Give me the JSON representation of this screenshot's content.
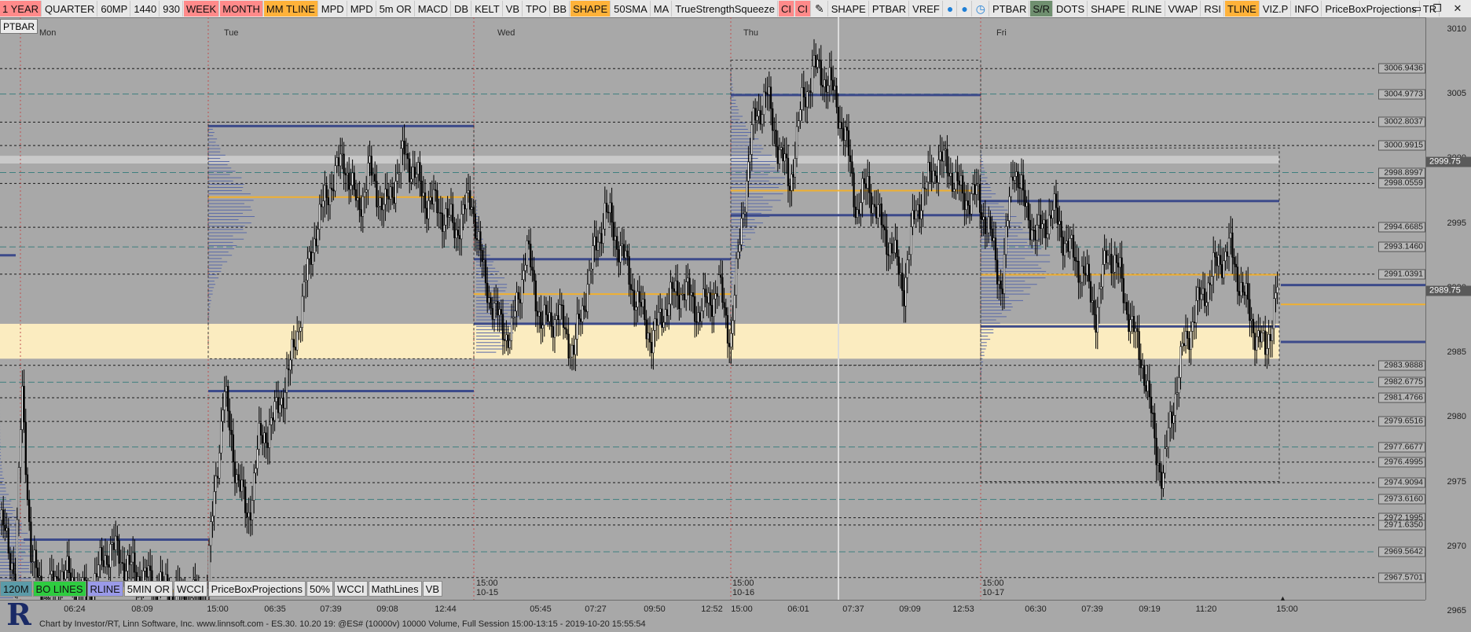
{
  "toolbar": {
    "items": [
      {
        "label": "1 YEAR",
        "bg": "#ff8a8a"
      },
      {
        "label": "QUARTER",
        "bg": ""
      },
      {
        "label": "60MP",
        "bg": ""
      },
      {
        "label": "1440",
        "bg": ""
      },
      {
        "label": "930",
        "bg": ""
      },
      {
        "label": "WEEK",
        "bg": "#ff8a8a"
      },
      {
        "label": "MONTH",
        "bg": "#ff8a8a"
      },
      {
        "label": "MM TLINE",
        "bg": "#ffb23a"
      },
      {
        "label": "MPD",
        "bg": ""
      },
      {
        "label": "MPD",
        "bg": ""
      },
      {
        "label": "5m OR",
        "bg": ""
      },
      {
        "label": "MACD",
        "bg": ""
      },
      {
        "label": "DB",
        "bg": ""
      },
      {
        "label": "KELT",
        "bg": ""
      },
      {
        "label": "VB",
        "bg": ""
      },
      {
        "label": "TPO",
        "bg": ""
      },
      {
        "label": "BB",
        "bg": ""
      },
      {
        "label": "SHAPE",
        "bg": "#ffb23a"
      },
      {
        "label": "50SMA",
        "bg": ""
      },
      {
        "label": "MA",
        "bg": ""
      },
      {
        "label": "TrueStrengthSqueeze",
        "bg": ""
      },
      {
        "label": "CI",
        "bg": "#ff8a8a"
      },
      {
        "label": "CI",
        "bg": "#ff8a8a"
      }
    ],
    "items2": [
      {
        "label": "SHAPE",
        "bg": ""
      },
      {
        "label": "PTBAR",
        "bg": ""
      },
      {
        "label": "VREF",
        "bg": ""
      }
    ],
    "items3": [
      {
        "label": "PTBAR",
        "bg": ""
      },
      {
        "label": "S/R",
        "bg": "#6f8f6f"
      },
      {
        "label": "DOTS",
        "bg": ""
      },
      {
        "label": "SHAPE",
        "bg": ""
      },
      {
        "label": "RLINE",
        "bg": ""
      },
      {
        "label": "VWAP",
        "bg": ""
      },
      {
        "label": "RSI",
        "bg": ""
      },
      {
        "label": "TLINE",
        "bg": "#ffb23a"
      },
      {
        "label": "VIZ.P",
        "bg": ""
      },
      {
        "label": "INFO",
        "bg": ""
      },
      {
        "label": "PriceBoxProjections",
        "bg": ""
      },
      {
        "label": "TR",
        "bg": ""
      }
    ]
  },
  "ptbar_label": "PTBAR",
  "days": [
    "Mon",
    "Tue",
    "Wed",
    "Thu",
    "Fri"
  ],
  "price_axis": {
    "ticks": [
      "3010",
      "3005",
      "3000",
      "2995",
      "2990",
      "2985",
      "2980",
      "2975",
      "2970",
      "2965"
    ],
    "current_prices": [
      {
        "value": "2999.75",
        "bg": "#5a5a5a"
      },
      {
        "value": "2989.75",
        "bg": "#5a5a5a"
      }
    ]
  },
  "levels": [
    "3006.9436",
    "3004.9773",
    "3002.8037",
    "3000.9915",
    "2998.8997",
    "2998.0559",
    "2994.6685",
    "2993.1460",
    "2991.0391",
    "2983.9888",
    "2982.6775",
    "2981.4766",
    "2979.6516",
    "2977.6677",
    "2976.4995",
    "2974.9094",
    "2973.6160",
    "2972.1995",
    "2971.6350",
    "2969.5642",
    "2967.5701"
  ],
  "bottom_toolbar": [
    {
      "label": "120M",
      "bg": "#5b9ba8"
    },
    {
      "label": "BO LINES",
      "bg": "#2ecc40"
    },
    {
      "label": "RLINE",
      "bg": "#9a9ae8"
    },
    {
      "label": "5MIN OR",
      "bg": ""
    },
    {
      "label": "WCCI",
      "bg": ""
    },
    {
      "label": "PriceBoxProjections",
      "bg": ""
    },
    {
      "label": "50%",
      "bg": ""
    },
    {
      "label": "WCCI",
      "bg": ""
    },
    {
      "label": "MathLines",
      "bg": ""
    },
    {
      "label": "VB",
      "bg": ""
    }
  ],
  "time_axis": {
    "ticks": [
      "06:24",
      "08:09",
      "15:00",
      "06:35",
      "07:39",
      "09:08",
      "12:44",
      "05:45",
      "07:27",
      "09:50",
      "12:52",
      "15:00",
      "06:01",
      "07:37",
      "09:09",
      "12:53",
      "06:30",
      "07:39",
      "09:19",
      "11:20",
      "15:00"
    ],
    "sessions": [
      {
        "time": "15:00",
        "date": "10-15"
      },
      {
        "time": "15:00",
        "date": "10-16"
      },
      {
        "time": "15:00",
        "date": "10-17"
      }
    ]
  },
  "footer": "Chart by Investor/RT, Linn Software, Inc. www.linnsoft.com - ES.30.   10.20 19: @ES# (10000v) 10000 Volume, Full Session 15:00-13:15 - 2019-10-20 15:55:54",
  "logo": "R",
  "colors": {
    "background": "#a8a8a8",
    "value_area": "#fbecc0",
    "poc_line": "#3c4a8a",
    "vwap_line": "#f0b030",
    "candles": "#000000"
  }
}
